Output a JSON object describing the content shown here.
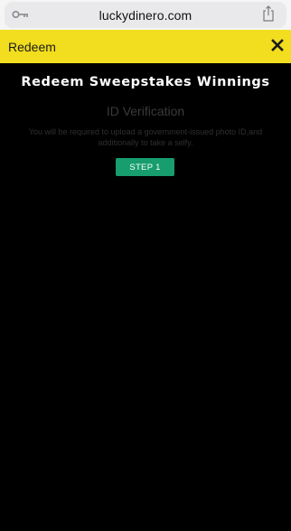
{
  "browser": {
    "url": "luckydinero.com",
    "key_icon": "key-icon",
    "share_icon": "share-icon"
  },
  "modal": {
    "title": "Redeem",
    "close_icon": "close-icon",
    "header_color": "#f2dd1e"
  },
  "content": {
    "heading": "Redeem Sweepstakes Winnings",
    "subheading": "ID Verification",
    "description": "You will be required to upload a government-issued photo ID,and additionally to take a selfy.",
    "step_button_label": "STEP 1",
    "accent_color": "#179d6e"
  }
}
